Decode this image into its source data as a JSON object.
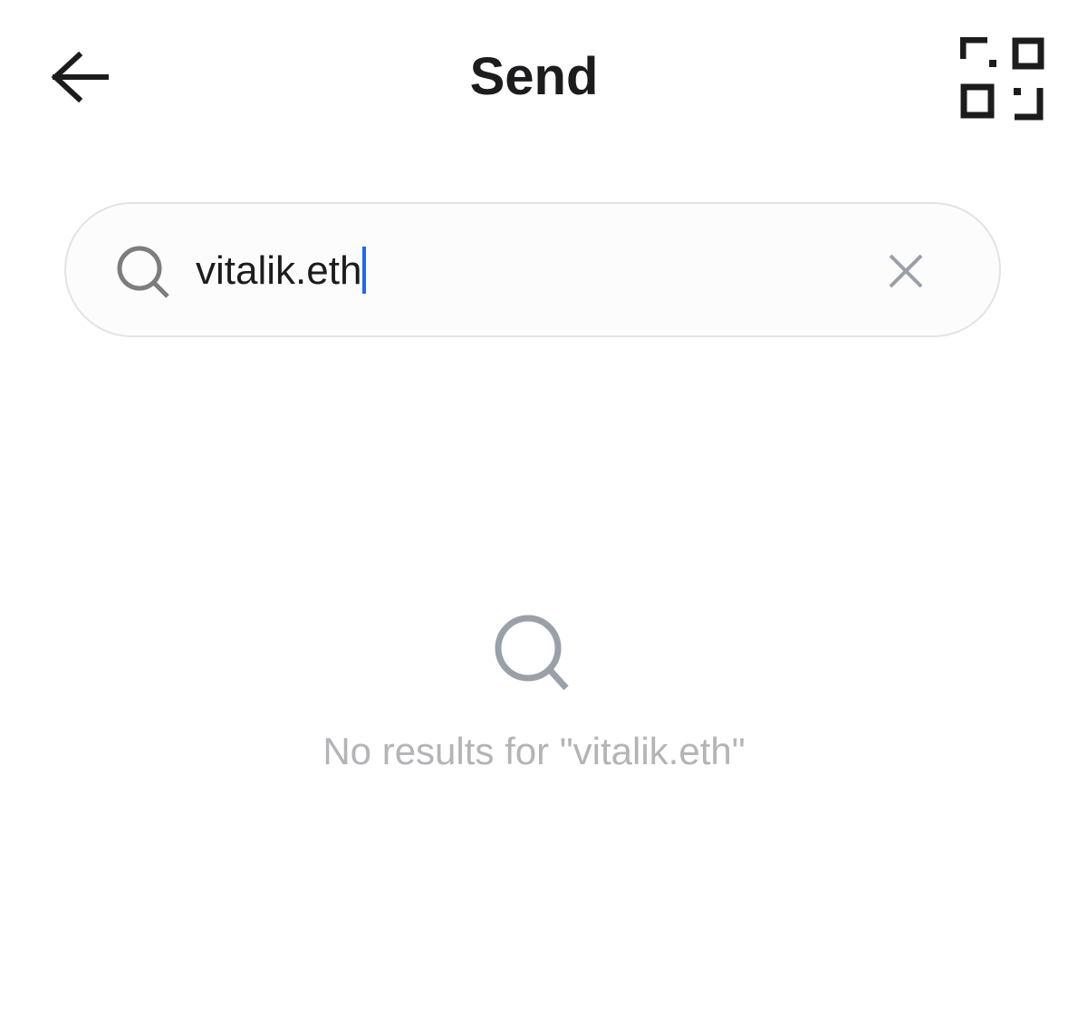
{
  "header": {
    "title": "Send",
    "back_icon": "arrow-left-icon",
    "qr_icon": "qr-scan-icon"
  },
  "search": {
    "value": "vitalik.eth",
    "icon": "search-icon",
    "clear_icon": "close-icon"
  },
  "empty_state": {
    "icon": "search-icon",
    "message": "No results for \"vitalik.eth\""
  },
  "colors": {
    "caret": "#1769ff",
    "muted_text": "#b4b4b8",
    "icon_gray": "#9aa0a8",
    "border": "#e3e3e3"
  }
}
